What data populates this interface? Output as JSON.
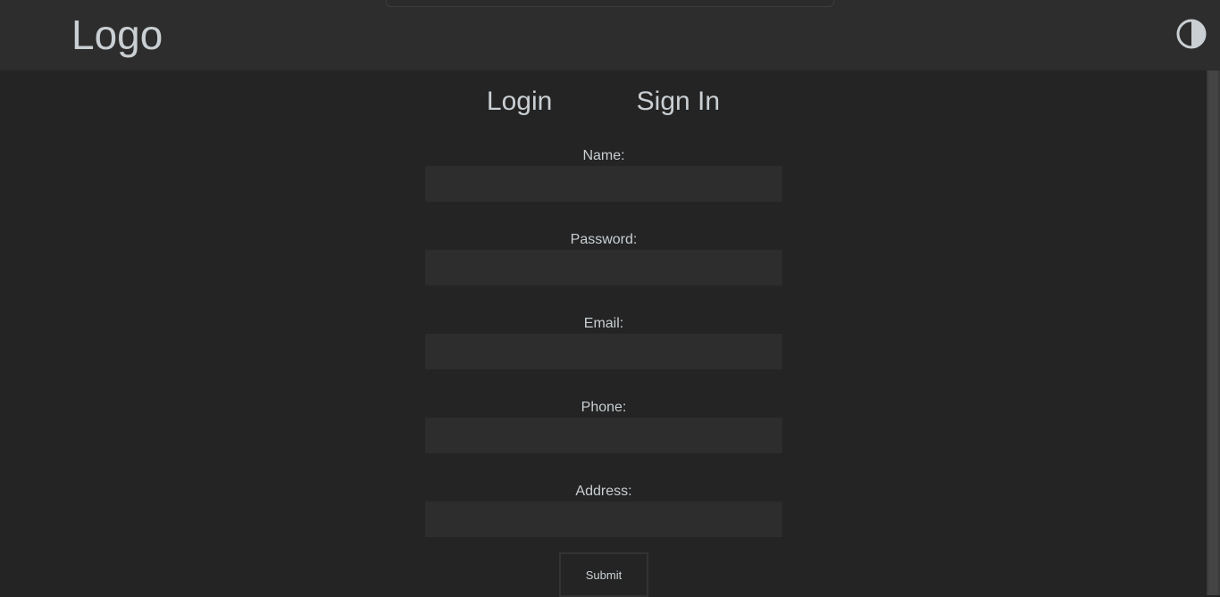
{
  "header": {
    "logo": "Logo",
    "theme_toggle_icon": "contrast-icon"
  },
  "tabs": [
    {
      "label": "Login"
    },
    {
      "label": "Sign In"
    }
  ],
  "form": {
    "fields": [
      {
        "label": "Name:",
        "value": "",
        "placeholder": ""
      },
      {
        "label": "Password:",
        "value": "",
        "placeholder": ""
      },
      {
        "label": "Email:",
        "value": "",
        "placeholder": ""
      },
      {
        "label": "Phone:",
        "value": "",
        "placeholder": ""
      },
      {
        "label": "Address:",
        "value": "",
        "placeholder": ""
      }
    ],
    "submit_label": "Submit"
  },
  "colors": {
    "background": "#242424",
    "header_background": "#2d2d2d",
    "input_background": "#2d2d2d",
    "text": "#c9cfd3"
  }
}
